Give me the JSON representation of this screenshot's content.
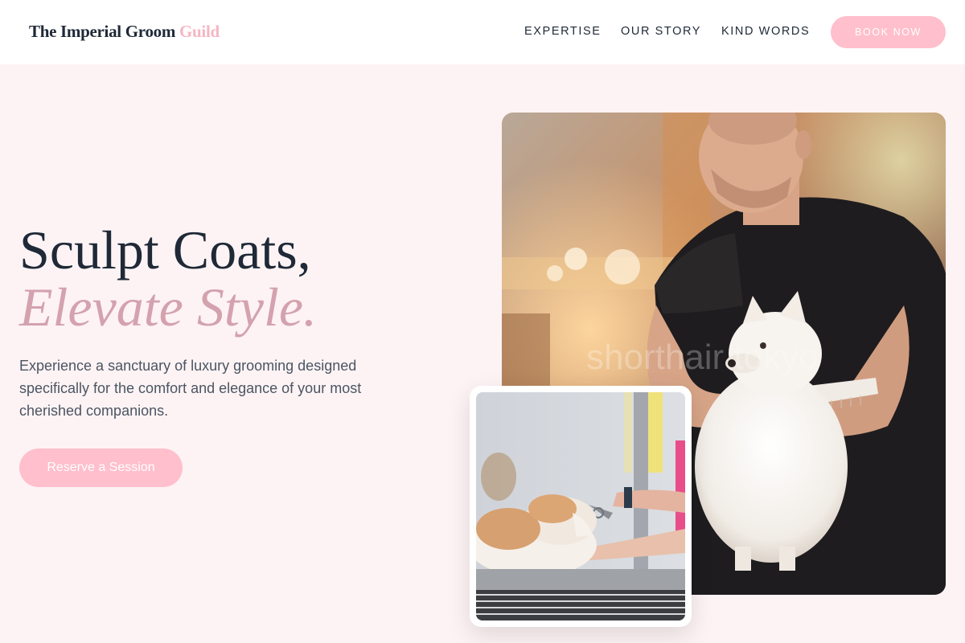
{
  "brand": {
    "name_main": "The Imperial Groom",
    "name_accent": "Guild",
    "accent_color": "#f4b6c2"
  },
  "nav": {
    "items": [
      {
        "label": "EXPERTISE"
      },
      {
        "label": "OUR STORY"
      },
      {
        "label": "KIND WORDS"
      }
    ],
    "cta_label": "BOOK NOW"
  },
  "hero": {
    "headline_line1": "Sculpt Coats,",
    "headline_line2": "Elevate Style.",
    "description": "Experience a sanctuary of luxury grooming designed specifically for the comfort and elegance of your most cherished companions.",
    "cta_label": "Reserve a Session"
  },
  "images": {
    "main": {
      "subject": "groomer combing a white pomeranian",
      "watermark": "shorthair tokyo"
    },
    "inset": {
      "subject": "groomer trimming an orange and white cat"
    }
  },
  "colors": {
    "page_background": "#fdf3f4",
    "button_pink": "#ffbfcc",
    "heading_dark": "#1f2937",
    "italic_pink": "#d4a2ae"
  }
}
